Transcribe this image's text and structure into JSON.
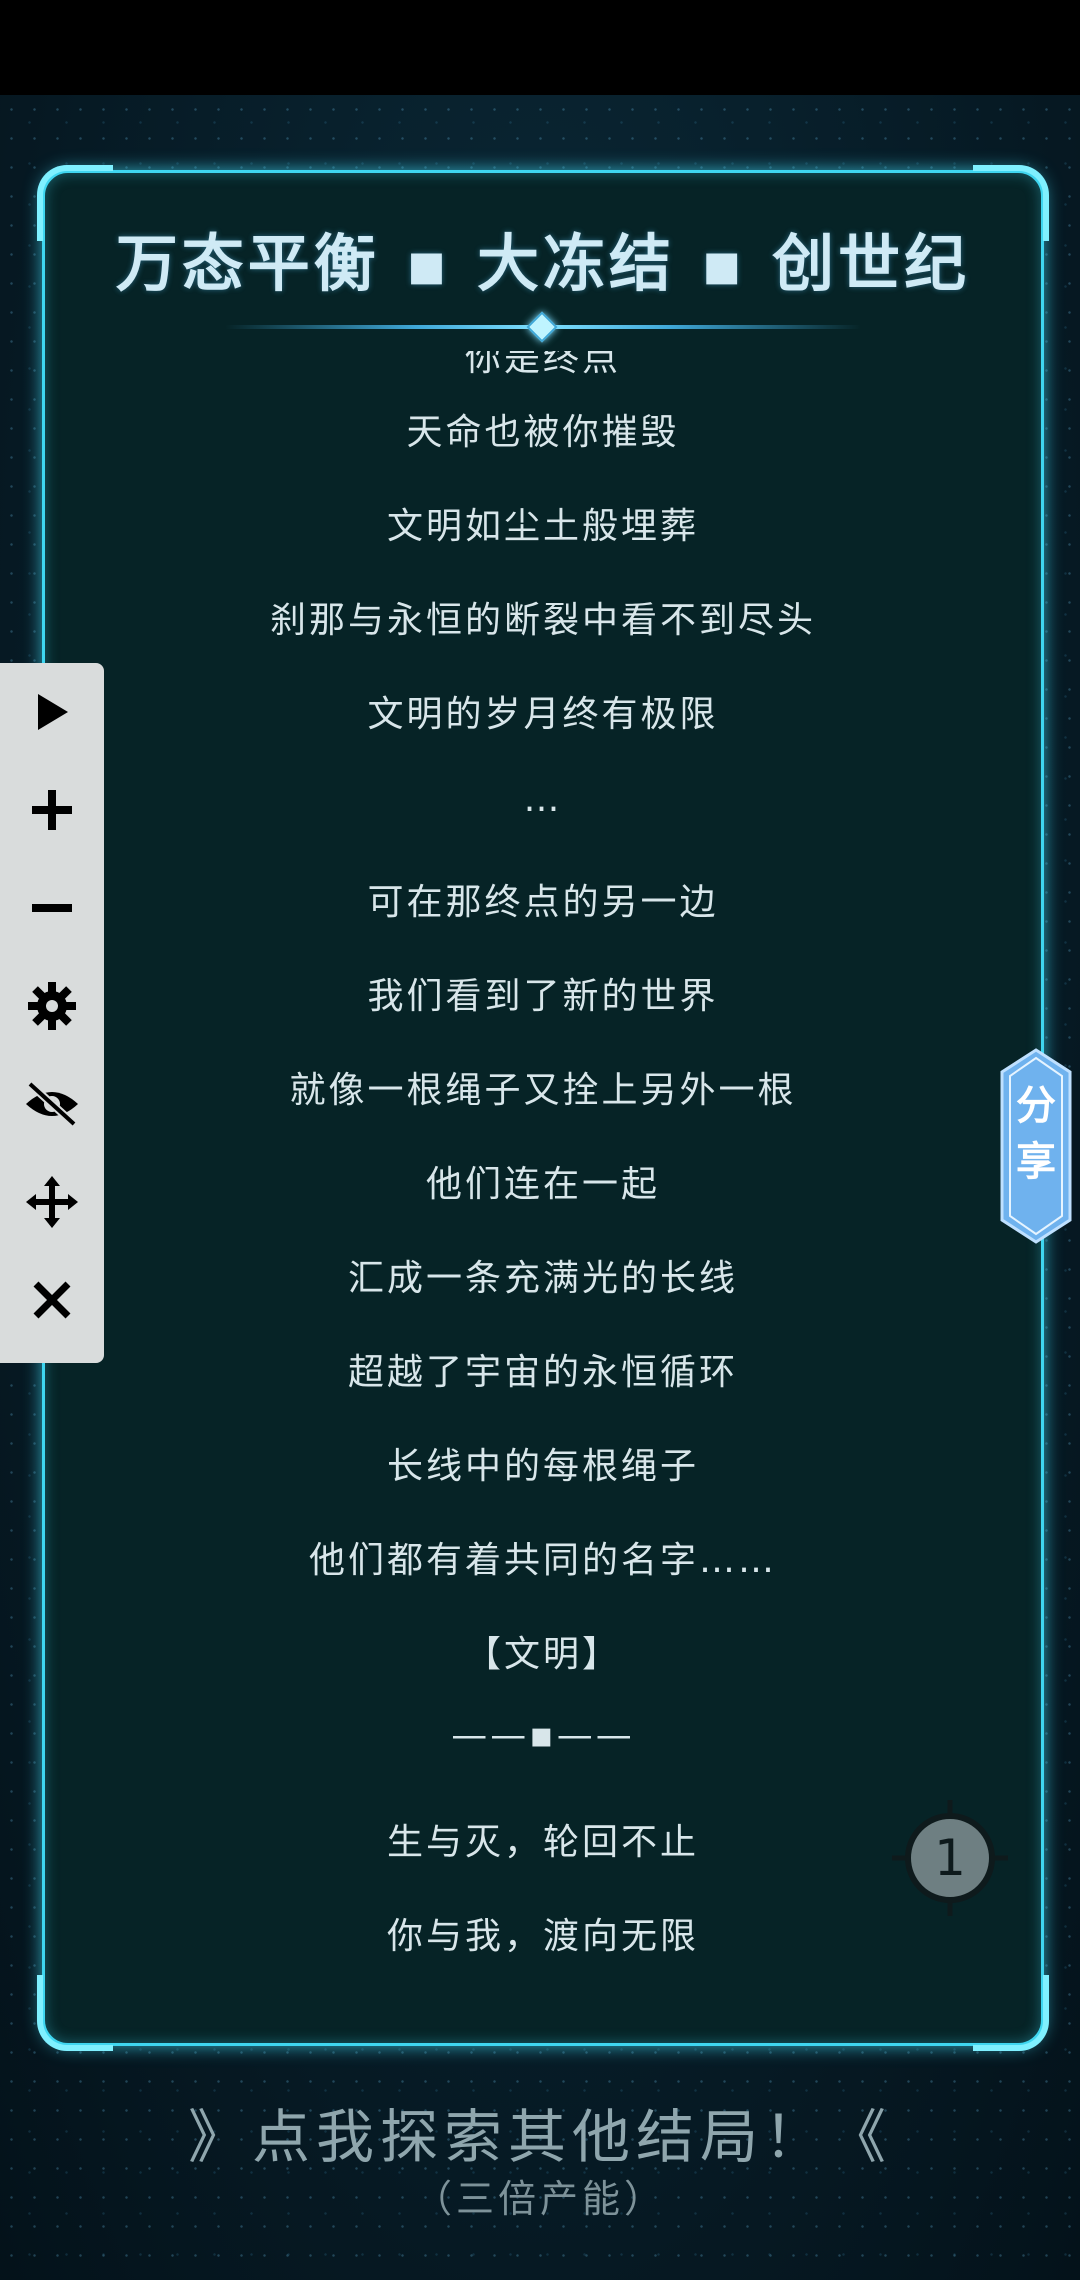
{
  "header": {
    "title": "万态平衡 ▪ 大冻结 ▪ 创世纪"
  },
  "lyrics": {
    "clipped_top": "你是终点",
    "lines": [
      "天命也被你摧毁",
      "文明如尘土般埋葬",
      "刹那与永恒的断裂中看不到尽头",
      "文明的岁月终有极限",
      "…",
      "可在那终点的另一边",
      "我们看到了新的世界",
      "就像一根绳子又拴上另外一根",
      "他们连在一起",
      "汇成一条充满光的长线",
      "超越了宇宙的永恒循环",
      "长线中的每根绳子",
      "他们都有着共同的名字……",
      "【文明】",
      "——▪——",
      "生与灭，轮回不止",
      "你与我，渡向无限"
    ]
  },
  "toolbar": {
    "items": [
      {
        "icon": "play-icon"
      },
      {
        "icon": "plus-icon"
      },
      {
        "icon": "minus-icon"
      },
      {
        "icon": "gear-icon"
      },
      {
        "icon": "eye-off-icon"
      },
      {
        "icon": "move-icon"
      },
      {
        "icon": "close-icon"
      }
    ]
  },
  "share": {
    "label": "分享"
  },
  "page_marker": {
    "number": "1"
  },
  "footer": {
    "explore_label": "》点我探索其他结局！《",
    "explore_sub": "（三倍产能）"
  },
  "colors": {
    "panel_border": "#3fd6f0",
    "panel_bg": "#062326",
    "share_tab": "#6fb2ee"
  }
}
